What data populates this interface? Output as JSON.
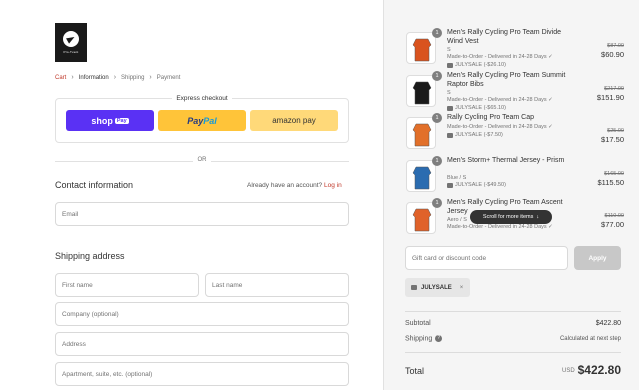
{
  "brand": {
    "logo_text": "Pro-Tvent"
  },
  "breadcrumb": [
    "Cart",
    "Information",
    "Shipping",
    "Payment"
  ],
  "express": {
    "title": "Express checkout",
    "shop_pay": "shop",
    "shop_pay_tag": "Pay",
    "paypal_a": "Pay",
    "paypal_b": "Pal",
    "amazon_pay": "amazon pay"
  },
  "or_label": "OR",
  "contact": {
    "title": "Contact information",
    "account_prompt": "Already have an account?",
    "login_link": "Log in",
    "email_placeholder": "Email"
  },
  "shipping": {
    "title": "Shipping address",
    "first_name": "First name",
    "last_name": "Last name",
    "company": "Company (optional)",
    "address": "Address",
    "apartment": "Apartment, suite, etc. (optional)"
  },
  "cart_items": [
    {
      "qty": "1",
      "name": "Men's Rally Cycling Pro Team Divide Wind Vest",
      "variant": "S",
      "made": "Made-to-Order - Delivered in 24-28 Days ✓",
      "discount": "JULYSALE (-$26.10)",
      "old_price": "$87.00",
      "price": "$60.90",
      "color": "#d9531e"
    },
    {
      "qty": "1",
      "name": "Men's Rally Cycling Pro Team Summit Raptor Bibs",
      "variant": "S",
      "made": "Made-to-Order - Delivered in 24-28 Days ✓",
      "discount": "JULYSALE (-$65.10)",
      "old_price": "$217.00",
      "price": "$151.90",
      "color": "#1a1a1a"
    },
    {
      "qty": "1",
      "name": "Rally Cycling Pro Team Cap",
      "variant": "",
      "made": "Made-to-Order - Delivered in 24-28 Days ✓",
      "discount": "JULYSALE (-$7.50)",
      "old_price": "$25.00",
      "price": "$17.50",
      "color": "#e2702a"
    },
    {
      "qty": "1",
      "name": "Men's Storm+ Thermal Jersey - Prism",
      "variant": "Blue / S",
      "made": "",
      "discount": "JULYSALE (-$49.50)",
      "old_price": "$165.00",
      "price": "$115.50",
      "color": "#2b6cb0"
    },
    {
      "qty": "1",
      "name": "Men's Rally Cycling Pro Team Ascent Jersey",
      "variant": "Aero / S",
      "made": "Made-to-Order - Delivered in 24-28 Days ✓",
      "discount": "",
      "old_price": "$110.00",
      "price": "$77.00",
      "color": "#e0622a"
    }
  ],
  "scroll_hint": "Scroll for more items",
  "discount": {
    "placeholder": "Gift card or discount code",
    "apply": "Apply",
    "code": "JULYSALE"
  },
  "totals": {
    "subtotal_label": "Subtotal",
    "subtotal_value": "$422.80",
    "shipping_label": "Shipping",
    "shipping_value": "Calculated at next step",
    "total_label": "Total",
    "currency": "USD",
    "total_value": "$422.80"
  }
}
